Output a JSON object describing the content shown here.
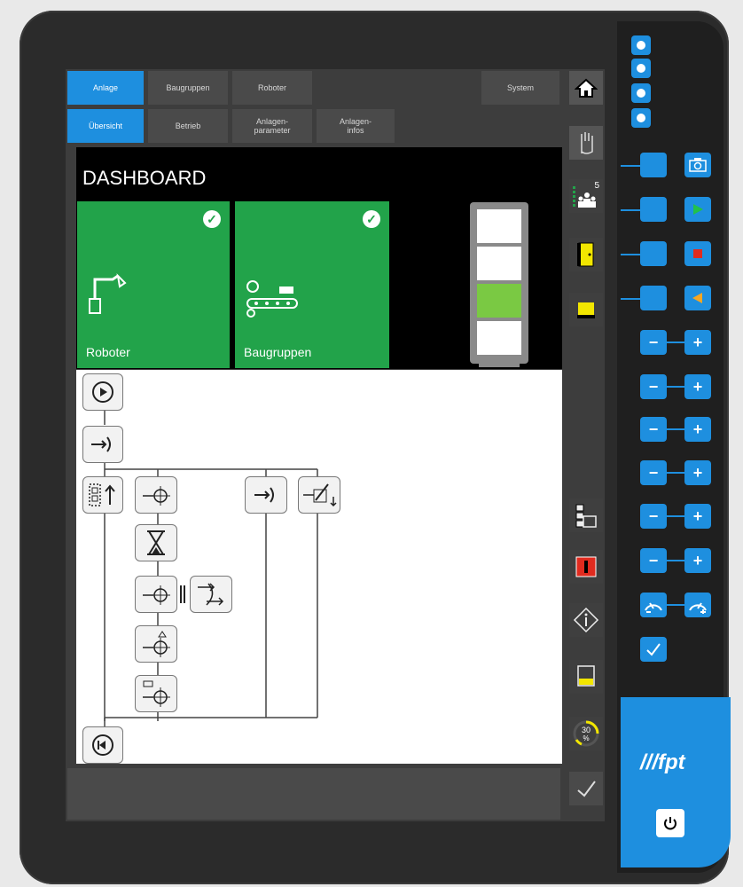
{
  "tabs_row1": [
    {
      "label": "Anlage",
      "active": true
    },
    {
      "label": "Baugruppen",
      "active": false
    },
    {
      "label": "Roboter",
      "active": false
    },
    {
      "label": "System",
      "active": false
    }
  ],
  "tabs_row2": [
    {
      "label": "Übersicht",
      "active": true
    },
    {
      "label": "Betrieb",
      "active": false
    },
    {
      "label": "Anlagen-\nparameter",
      "active": false
    },
    {
      "label": "Anlagen-\ninfos",
      "active": false
    }
  ],
  "dashboard": {
    "title": "DASHBOARD",
    "tiles": [
      {
        "label": "Roboter",
        "status": "ok"
      },
      {
        "label": "Baugruppen",
        "status": "ok"
      }
    ],
    "stack_light": [
      "off",
      "off",
      "green",
      "off"
    ]
  },
  "side_panel": {
    "operator_count": "5",
    "speed_percent": "30",
    "speed_unit": "%"
  },
  "brand": {
    "logo_text": "fpt",
    "accent": "#1e8fdf",
    "tile_green": "#22a34a"
  },
  "icons": {
    "home": "home-icon",
    "hand": "hand-icon",
    "door": "door-icon",
    "info": "info-icon",
    "power": "power-icon",
    "check": "check-icon"
  }
}
